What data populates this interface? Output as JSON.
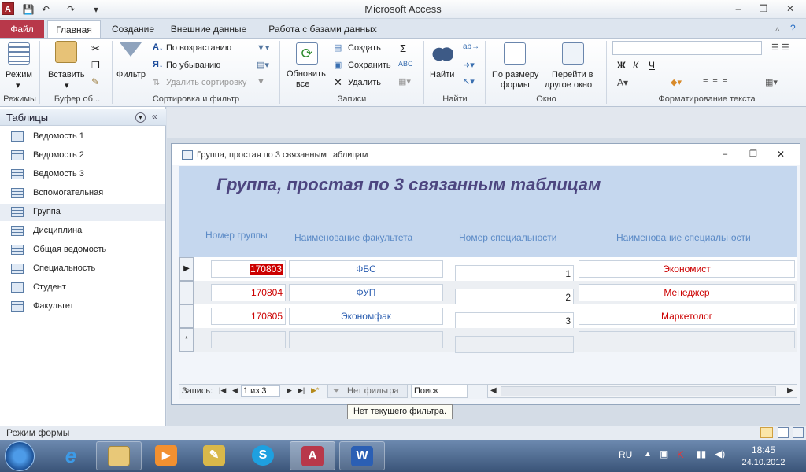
{
  "window": {
    "title": "Microsoft Access",
    "app_logo": "A"
  },
  "qat": {
    "save_icon": "save-icon",
    "undo_icon": "undo-icon",
    "redo_icon": "redo-icon"
  },
  "tabs": {
    "file": "Файл",
    "home": "Главная",
    "create": "Создание",
    "external": "Внешние данные",
    "dbtools": "Работа с базами данных"
  },
  "ribbon": {
    "views": {
      "mode": "Режим",
      "label": "Режимы"
    },
    "clipboard": {
      "paste": "Вставить",
      "label": "Буфер об..."
    },
    "sort": {
      "filter": "Фильтр",
      "asc": "По возрастанию",
      "desc": "По убыванию",
      "clear": "Удалить сортировку",
      "label": "Сортировка и фильтр"
    },
    "records": {
      "refresh1": "Обновить",
      "refresh2": "все",
      "new": "Создать",
      "save": "Сохранить",
      "delete": "Удалить",
      "label": "Записи"
    },
    "find": {
      "find": "Найти",
      "label": "Найти"
    },
    "window": {
      "fit1": "По размеру",
      "fit2": "формы",
      "goto1": "Перейти в",
      "goto2": "другое окно",
      "label": "Окно"
    },
    "text": {
      "bold": "Ж",
      "italic": "К",
      "underline": "Ч",
      "label": "Форматирование текста"
    }
  },
  "nav": {
    "title": "Таблицы",
    "items": [
      "Ведомость 1",
      "Ведомость 2",
      "Ведомость 3",
      "Вспомогательная",
      "Группа",
      "Дисциплина",
      "Общая ведомость",
      "Специальность",
      "Студент",
      "Факультет"
    ]
  },
  "form": {
    "window_title": "Группа, простая по 3 связанным таблицам",
    "heading": "Группа, простая по 3 связанным таблицам",
    "columns": [
      "Номер группы",
      "Наименование факультета",
      "Номер специальности",
      "Наименование специальности"
    ],
    "rows": [
      {
        "group": "170803",
        "faculty": "ФБС",
        "spec_no": "1",
        "spec_name": "Экономист"
      },
      {
        "group": "170804",
        "faculty": "ФУП",
        "spec_no": "2",
        "spec_name": "Менеджер"
      },
      {
        "group": "170805",
        "faculty": "Экономфак",
        "spec_no": "3",
        "spec_name": "Маркетолог"
      }
    ],
    "new_row_marker": "*",
    "current_row_marker": "▶"
  },
  "record_nav": {
    "label": "Запись:",
    "position": "1 из 3",
    "filter": "Нет фильтра",
    "search": "Поиск"
  },
  "tooltip": "Нет текущего фильтра.",
  "status": {
    "text": "Режим формы"
  },
  "taskbar": {
    "lang": "RU",
    "time": "18:45",
    "date": "24.10.2012"
  },
  "colors": {
    "accent": "#b8384a",
    "heading": "#4d4680",
    "column_header": "#5b8ac6",
    "value_red": "#cc0000",
    "value_blue": "#2a5db0"
  }
}
